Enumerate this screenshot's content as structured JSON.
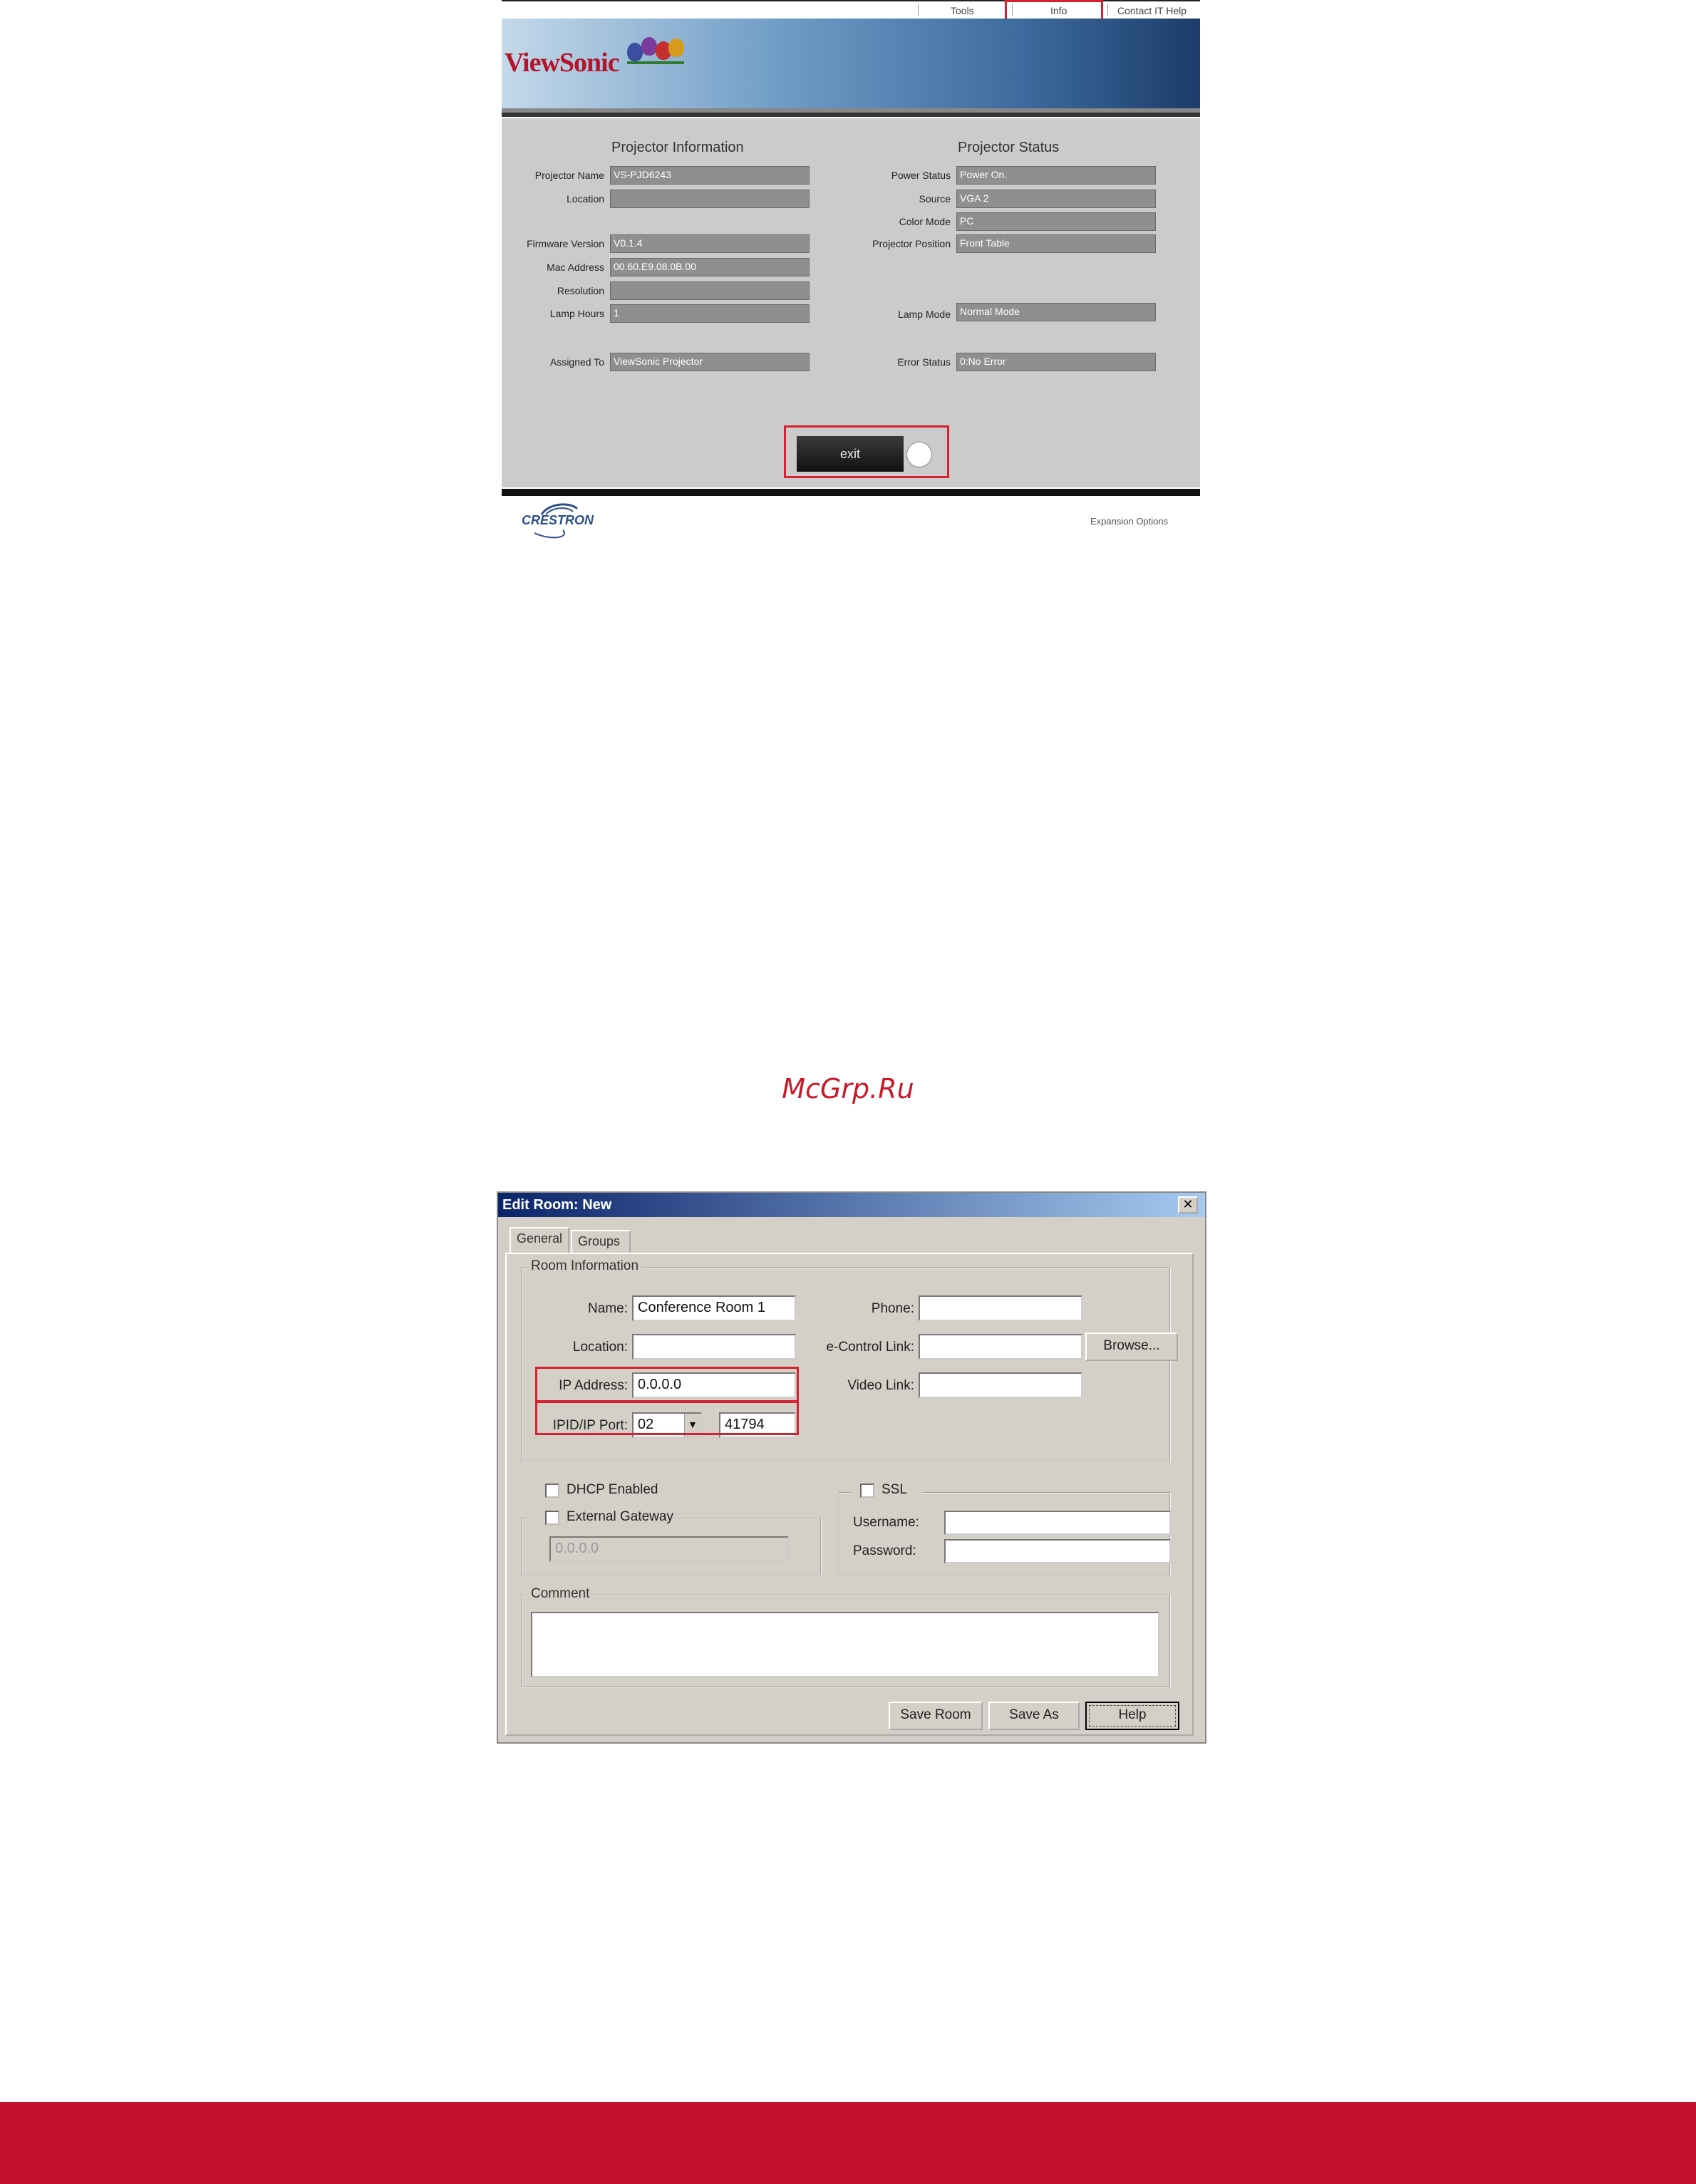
{
  "web_ui": {
    "nav": {
      "tools": "Tools",
      "info": "Info",
      "contact": "Contact IT Help"
    },
    "logo": "ViewSonic",
    "info_section_title": "Projector Information",
    "status_section_title": "Projector Status",
    "info_fields": [
      {
        "label": "Projector Name",
        "value": "VS-PJD6243"
      },
      {
        "label": "Location",
        "value": ""
      },
      {
        "label": "Firmware Version",
        "value": "V0.1.4"
      },
      {
        "label": "Mac Address",
        "value": "00.60.E9.08.0B.00"
      },
      {
        "label": "Resolution",
        "value": ""
      },
      {
        "label": "Lamp Hours",
        "value": "1"
      },
      {
        "label": "Assigned To",
        "value": "ViewSonic Projector"
      }
    ],
    "status_fields": [
      {
        "label": "Power Status",
        "value": "Power On."
      },
      {
        "label": "Source",
        "value": "VGA 2"
      },
      {
        "label": "Color Mode",
        "value": "PC"
      },
      {
        "label": "Projector Position",
        "value": "Front Table"
      },
      {
        "label": "Lamp Mode",
        "value": "Normal Mode"
      },
      {
        "label": "Error Status",
        "value": "0:No Error"
      }
    ],
    "exit_label": "exit",
    "footer_logo": "CRESTRON",
    "expansion_options": "Expansion Options"
  },
  "watermark": "McGrp.Ru",
  "dialog": {
    "title": "Edit Room: New",
    "close": "✕",
    "tabs": [
      "General",
      "Groups"
    ],
    "room_info_label": "Room Information",
    "name_label": "Name:",
    "name_value": "Conference Room 1",
    "location_label": "Location:",
    "location_value": "",
    "ip_label": "IP Address:",
    "ip_value": "0.0.0.0",
    "ipid_label": "IPID/IP Port:",
    "ipid_value": "02",
    "port_value": "41794",
    "phone_label": "Phone:",
    "phone_value": "",
    "econtrol_label": "e-Control Link:",
    "econtrol_value": "",
    "browse_label": "Browse...",
    "video_label": "Video Link:",
    "video_value": "",
    "dhcp_label": "DHCP Enabled",
    "gateway_label": "External Gateway",
    "gateway_value": "0.0.0.0",
    "ssl_label": "SSL",
    "username_label": "Username:",
    "username_value": "",
    "password_label": "Password:",
    "password_value": "",
    "comment_label": "Comment",
    "comment_value": "",
    "save_room_label": "Save Room",
    "save_as_label": "Save As",
    "help_label": "Help"
  }
}
